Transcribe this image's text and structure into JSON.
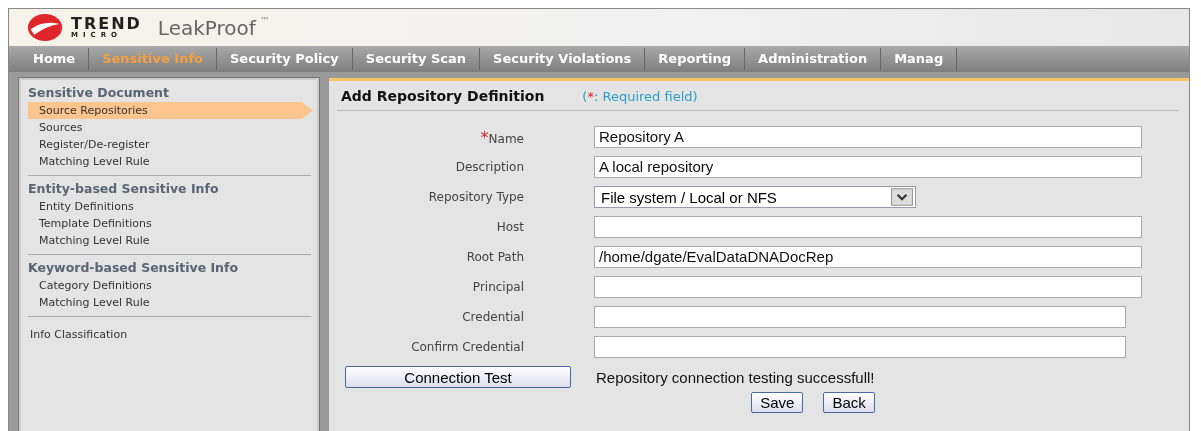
{
  "brand": {
    "company_top": "TREND",
    "company_bottom": "MICRO",
    "product": "LeakProof",
    "trademark": "™"
  },
  "nav": [
    {
      "label": "Home",
      "selected": false
    },
    {
      "label": "Sensitive Info",
      "selected": true
    },
    {
      "label": "Security Policy",
      "selected": false
    },
    {
      "label": "Security Scan",
      "selected": false
    },
    {
      "label": "Security Violations",
      "selected": false
    },
    {
      "label": "Reporting",
      "selected": false
    },
    {
      "label": "Administration",
      "selected": false
    },
    {
      "label": "Manag",
      "selected": false
    }
  ],
  "sidebar": [
    {
      "kind": "group",
      "title": "Sensitive Document",
      "items": [
        {
          "label": "Source Repositories",
          "selected": true
        },
        {
          "label": "Sources",
          "selected": false
        },
        {
          "label": "Register/De-register",
          "selected": false
        },
        {
          "label": "Matching Level Rule",
          "selected": false
        }
      ]
    },
    {
      "kind": "group",
      "title": "Entity-based Sensitive Info",
      "items": [
        {
          "label": "Entity Definitions",
          "selected": false
        },
        {
          "label": "Template Definitions",
          "selected": false
        },
        {
          "label": "Matching Level Rule",
          "selected": false
        }
      ]
    },
    {
      "kind": "group",
      "title": "Keyword-based Sensitive Info",
      "items": [
        {
          "label": "Category Definitions",
          "selected": false
        },
        {
          "label": "Matching Level Rule",
          "selected": false
        }
      ]
    },
    {
      "kind": "link",
      "title": "Info Classification"
    }
  ],
  "form": {
    "title": "Add Repository Definition",
    "required_note": {
      "open": "(",
      "mark": "*",
      "rest": ": Required field)"
    },
    "fields": [
      {
        "label": "Name",
        "required": true,
        "kind": "text",
        "value": "Repository A"
      },
      {
        "label": "Description",
        "required": false,
        "kind": "text",
        "value": "A local repository"
      },
      {
        "label": "Repository Type",
        "required": false,
        "kind": "select",
        "value": "File system / Local or NFS"
      },
      {
        "label": "Host",
        "required": false,
        "kind": "text"
      },
      {
        "label": "Root Path",
        "required": false,
        "kind": "text",
        "value": "/home/dgate/EvalDataDNADocRep"
      },
      {
        "label": "Principal",
        "required": false,
        "kind": "text"
      },
      {
        "label": "Credential",
        "required": false,
        "kind": "password"
      },
      {
        "label": "Confirm Credential",
        "required": false,
        "kind": "password"
      }
    ],
    "test_button": "Connection Test",
    "test_message": "Repository connection testing successfull!",
    "buttons": [
      "Save",
      "Back"
    ]
  }
}
